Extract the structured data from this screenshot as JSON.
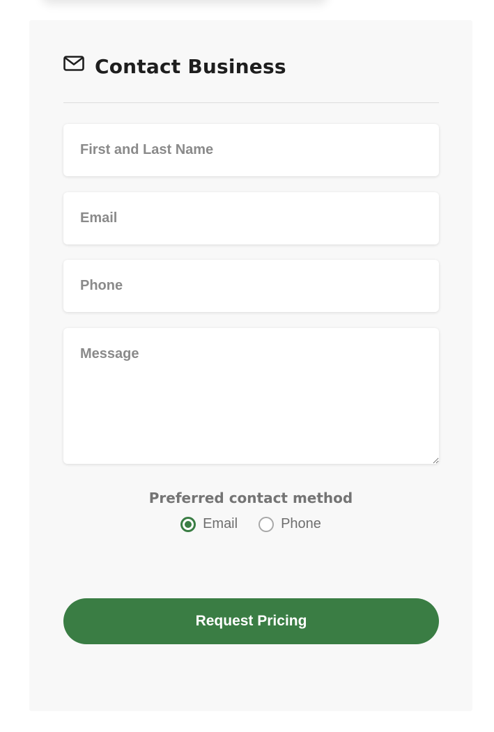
{
  "colors": {
    "accent": "#3a7d44",
    "card_background": "#f8f8f8",
    "placeholder": "#8a8a8a"
  },
  "contact_card": {
    "icon": "envelope-icon",
    "title": "Contact Business"
  },
  "form": {
    "name_placeholder": "First and Last Name",
    "email_placeholder": "Email",
    "phone_placeholder": "Phone",
    "message_placeholder": "Message"
  },
  "preferred_contact": {
    "label": "Preferred contact method",
    "options": [
      {
        "label": "Email",
        "selected": true
      },
      {
        "label": "Phone",
        "selected": false
      }
    ]
  },
  "submit_label": "Request Pricing"
}
